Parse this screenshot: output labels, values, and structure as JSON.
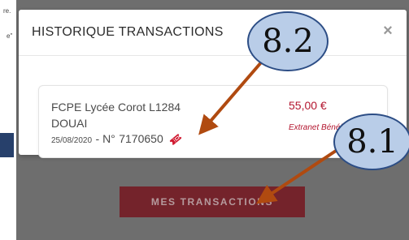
{
  "background_page": {
    "snippet_1": "re.",
    "snippet_2": "e\""
  },
  "modal": {
    "title": "HISTORIQUE TRANSACTIONS",
    "close_label": "×",
    "transaction": {
      "name": "FCPE Lycée Corot L1284 DOUAI",
      "date": "25/08/2020",
      "separator": "- N°",
      "number": "7170650",
      "amount": "55,00 €",
      "method": "Extranet Bénéfice"
    }
  },
  "mes_transactions_button": "MES TRANSACTIONS",
  "callouts": {
    "callout_8_2": "8.2",
    "callout_8_1": "8.1"
  },
  "colors": {
    "overlay": "#6e6e6e",
    "brand_red": "#b3162f",
    "button_bg": "#74232b",
    "callout_fill": "#b9cde8",
    "callout_border": "#2c4d85",
    "arrow": "#b04a10"
  },
  "icons": {
    "ticket": "ticket-icon",
    "close": "close-icon"
  }
}
